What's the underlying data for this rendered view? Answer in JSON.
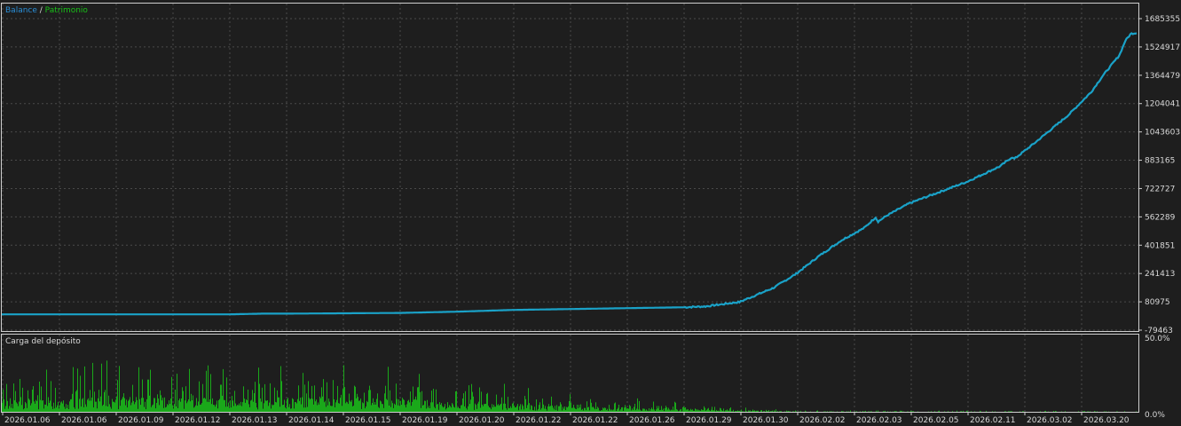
{
  "legend": {
    "balance_label": "Balance",
    "separator": " / ",
    "equity_label": "Patrimonio",
    "balance_color": "#2a8fd8",
    "equity_color": "#18c018"
  },
  "lower_panel": {
    "title": "Carga del depósito",
    "bar_color": "#1aa81a"
  },
  "colors": {
    "background": "#1e1e1e",
    "grid": "#4a4a4a",
    "border": "#cfcfcf",
    "line": "#1aa2c8"
  },
  "chart_data": [
    {
      "type": "line",
      "series": [
        {
          "name": "Balance",
          "color": "#2a8fd8"
        },
        {
          "name": "Patrimonio",
          "color": "#18c018"
        }
      ],
      "y_ticks": [
        "1685355",
        "1524917",
        "1364479",
        "1204041",
        "1043603",
        "883165",
        "722727",
        "562289",
        "401851",
        "241413",
        "80975",
        "-79463"
      ],
      "ylim": [
        -79463,
        1685355
      ],
      "x_ticks": [
        "2026.01.06",
        "2026.01.06",
        "2026.01.09",
        "2026.01.12",
        "2026.01.13",
        "2026.01.14",
        "2026.01.15",
        "2026.01.19",
        "2026.01.20",
        "2026.01.22",
        "2026.01.22",
        "2026.01.26",
        "2026.01.29",
        "2026.01.30",
        "2026.02.02",
        "2026.02.03",
        "2026.02.05",
        "2026.02.11",
        "2026.03.02",
        "2026.03.20"
      ],
      "x": [
        0,
        0.05,
        0.1,
        0.15,
        0.2,
        0.23,
        0.25,
        0.3,
        0.35,
        0.4,
        0.45,
        0.5,
        0.55,
        0.6,
        0.62,
        0.65,
        0.68,
        0.7,
        0.72,
        0.74,
        0.76,
        0.77,
        0.772,
        0.78,
        0.8,
        0.85,
        0.88,
        0.89,
        0.892,
        0.91,
        0.94,
        0.96,
        0.97,
        0.985,
        0.99,
        0.995,
        1.0
      ],
      "values": [
        10000,
        10000,
        10000,
        10000,
        10000,
        14000,
        14000,
        16000,
        18000,
        25000,
        35000,
        40000,
        45000,
        50000,
        55000,
        80000,
        160000,
        240000,
        340000,
        430000,
        500000,
        560000,
        535000,
        570000,
        640000,
        760000,
        850000,
        900000,
        890000,
        980000,
        1140000,
        1270000,
        1360000,
        1480000,
        1560000,
        1600000,
        1605000
      ],
      "grid": true,
      "legend": "top-left"
    },
    {
      "type": "bar",
      "title": "Carga del depósito",
      "y_ticks": [
        "50.0%",
        "0.0%"
      ],
      "ylim": [
        0,
        50
      ],
      "profile_x": [
        0,
        0.1,
        0.2,
        0.3,
        0.35,
        0.4,
        0.45,
        0.5,
        0.55,
        0.6,
        0.65,
        0.7,
        1.0
      ],
      "profile_peak": [
        30,
        34,
        30,
        34,
        30,
        22,
        18,
        12,
        10,
        6,
        3,
        1,
        0.5
      ]
    }
  ]
}
